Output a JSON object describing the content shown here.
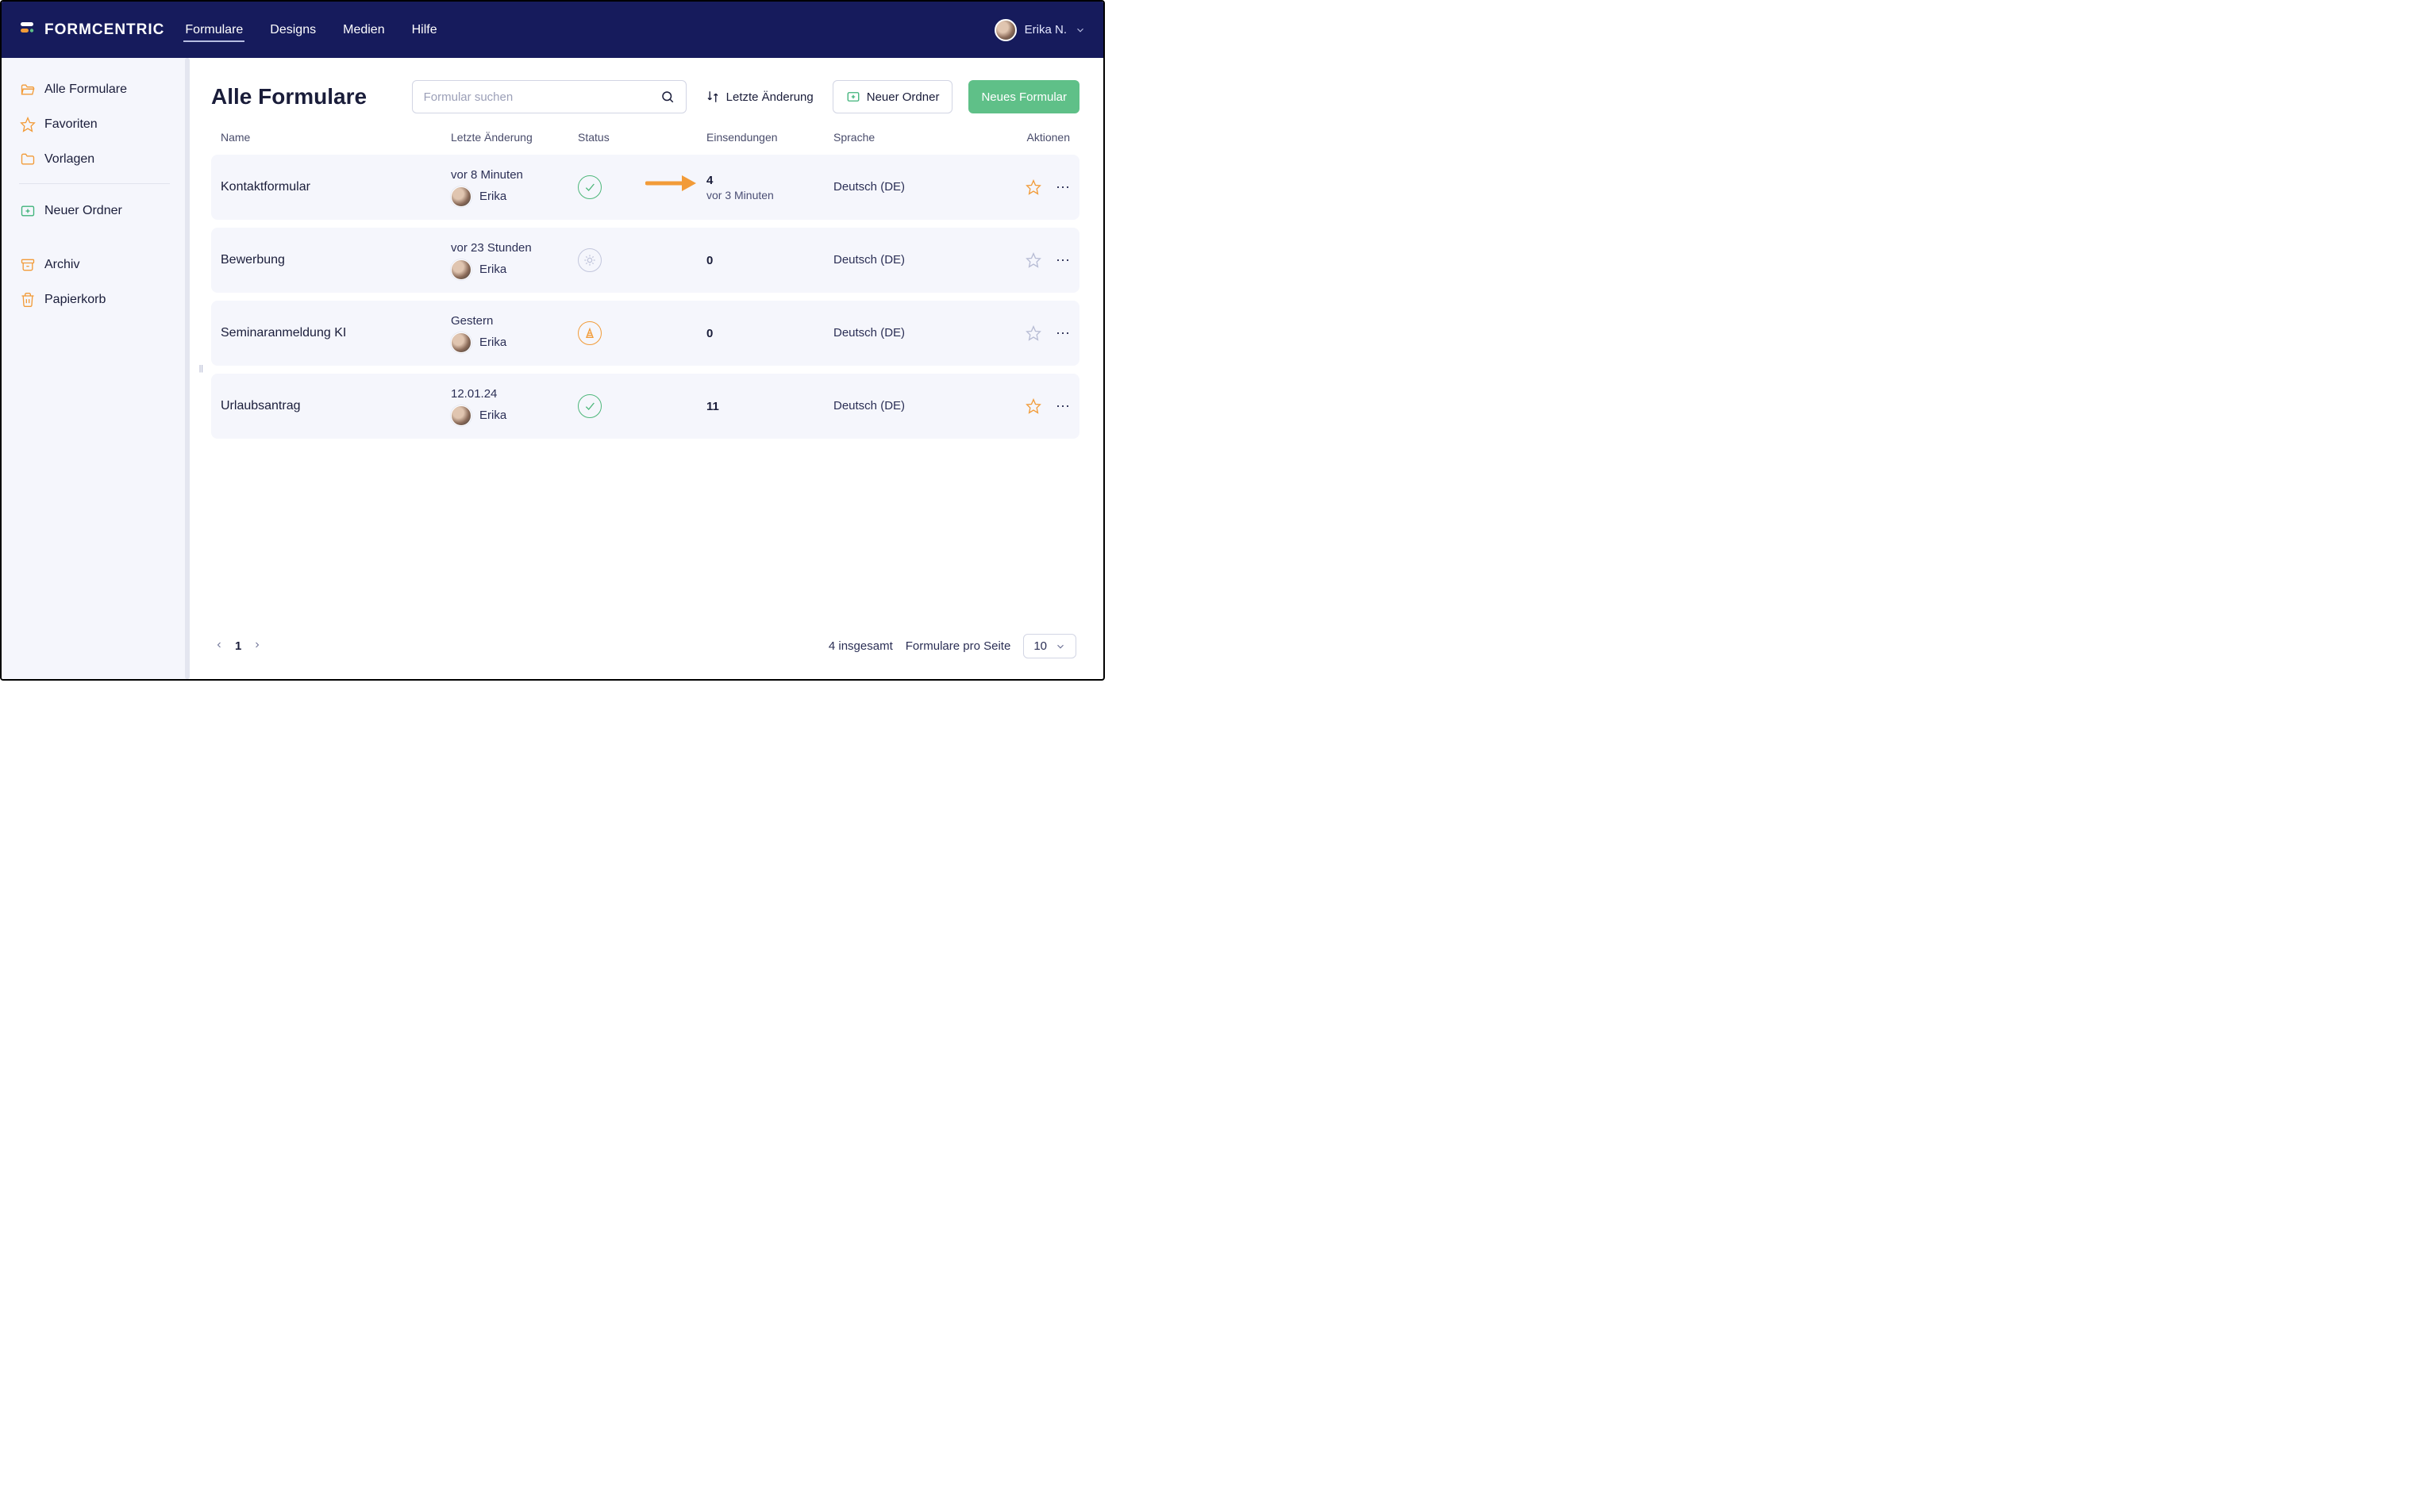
{
  "brand": {
    "name": "FORMCENTRIC"
  },
  "nav": {
    "items": [
      {
        "label": "Formulare",
        "active": true
      },
      {
        "label": "Designs"
      },
      {
        "label": "Medien"
      },
      {
        "label": "Hilfe"
      }
    ],
    "user": "Erika N."
  },
  "sidebar": {
    "all_forms": "Alle Formulare",
    "favorites": "Favoriten",
    "templates": "Vorlagen",
    "new_folder": "Neuer Ordner",
    "archive": "Archiv",
    "trash": "Papierkorb"
  },
  "page": {
    "title": "Alle Formulare",
    "search_placeholder": "Formular suchen",
    "sort_label": "Letzte Änderung",
    "new_folder": "Neuer Ordner",
    "new_form": "Neues Formular"
  },
  "columns": {
    "name": "Name",
    "last_change": "Letzte Änderung",
    "status": "Status",
    "submissions": "Einsendungen",
    "language": "Sprache",
    "actions": "Aktionen"
  },
  "rows": [
    {
      "name": "Kontaktformular",
      "change_time": "vor 8 Minuten",
      "change_user": "Erika",
      "status": "published",
      "submissions": "4",
      "submissions_time": "vor 3 Minuten",
      "language": "Deutsch (DE)",
      "favorite": true,
      "highlight_arrow": true
    },
    {
      "name": "Bewerbung",
      "change_time": "vor 23 Stunden",
      "change_user": "Erika",
      "status": "draft",
      "submissions": "0",
      "submissions_time": "",
      "language": "Deutsch (DE)",
      "favorite": false
    },
    {
      "name": "Seminaranmeldung KI",
      "change_time": "Gestern",
      "change_user": "Erika",
      "status": "pending",
      "submissions": "0",
      "submissions_time": "",
      "language": "Deutsch (DE)",
      "favorite": false
    },
    {
      "name": "Urlaubsantrag",
      "change_time": "12.01.24",
      "change_user": "Erika",
      "status": "published",
      "submissions": "11",
      "submissions_time": "",
      "language": "Deutsch (DE)",
      "favorite": true
    }
  ],
  "pager": {
    "current": "1",
    "total_text": "4 insgesamt",
    "per_page_label": "Formulare pro Seite",
    "per_page_value": "10"
  }
}
